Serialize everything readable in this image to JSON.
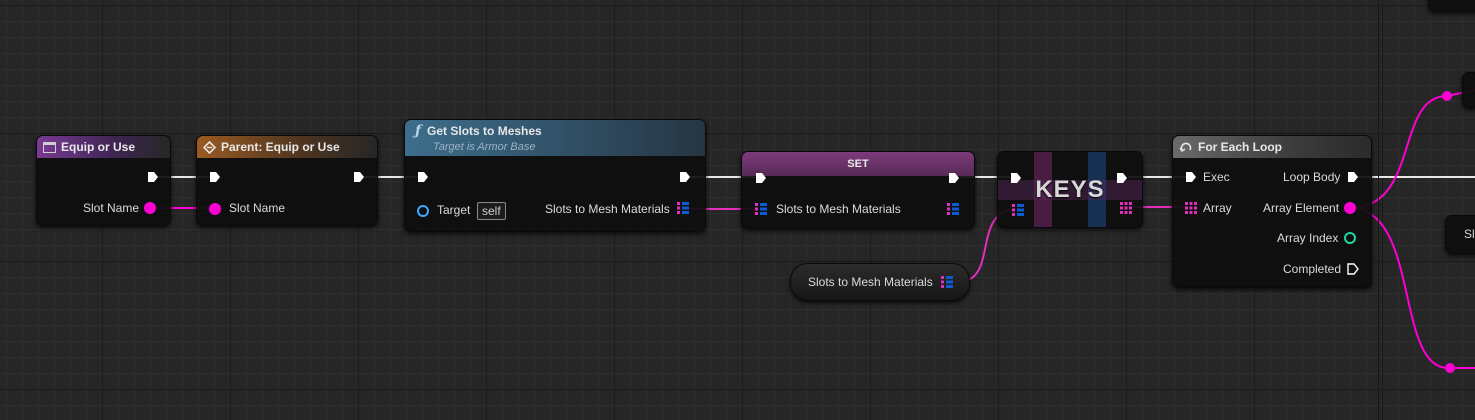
{
  "nodes": {
    "equip": {
      "title": "Equip or Use",
      "slot_name": "Slot Name"
    },
    "parent": {
      "title": "Parent: Equip or Use",
      "slot_name": "Slot Name"
    },
    "get_slots": {
      "title": "Get Slots to Meshes",
      "subtitle": "Target is Armor Base",
      "target": "Target",
      "self": "self",
      "output": "Slots to Mesh Materials"
    },
    "set": {
      "title": "SET",
      "input": "Slots to Mesh Materials"
    },
    "var": {
      "label": "Slots to Mesh Materials"
    },
    "keys": {
      "title": "KEYS"
    },
    "foreach": {
      "title": "For Each Loop",
      "exec": "Exec",
      "array": "Array",
      "loop_body": "Loop Body",
      "array_element": "Array Element",
      "array_index": "Array Index",
      "completed": "Completed"
    },
    "edge": {
      "label": "Sl"
    }
  },
  "colors": {
    "exec": "#ffffff",
    "string_pin": "#fb00d1",
    "map_key": "#e22fbd",
    "map_value": "#0a5bd6",
    "object_pin": "#3aa8ff",
    "int_pin": "#1ed6a0"
  }
}
